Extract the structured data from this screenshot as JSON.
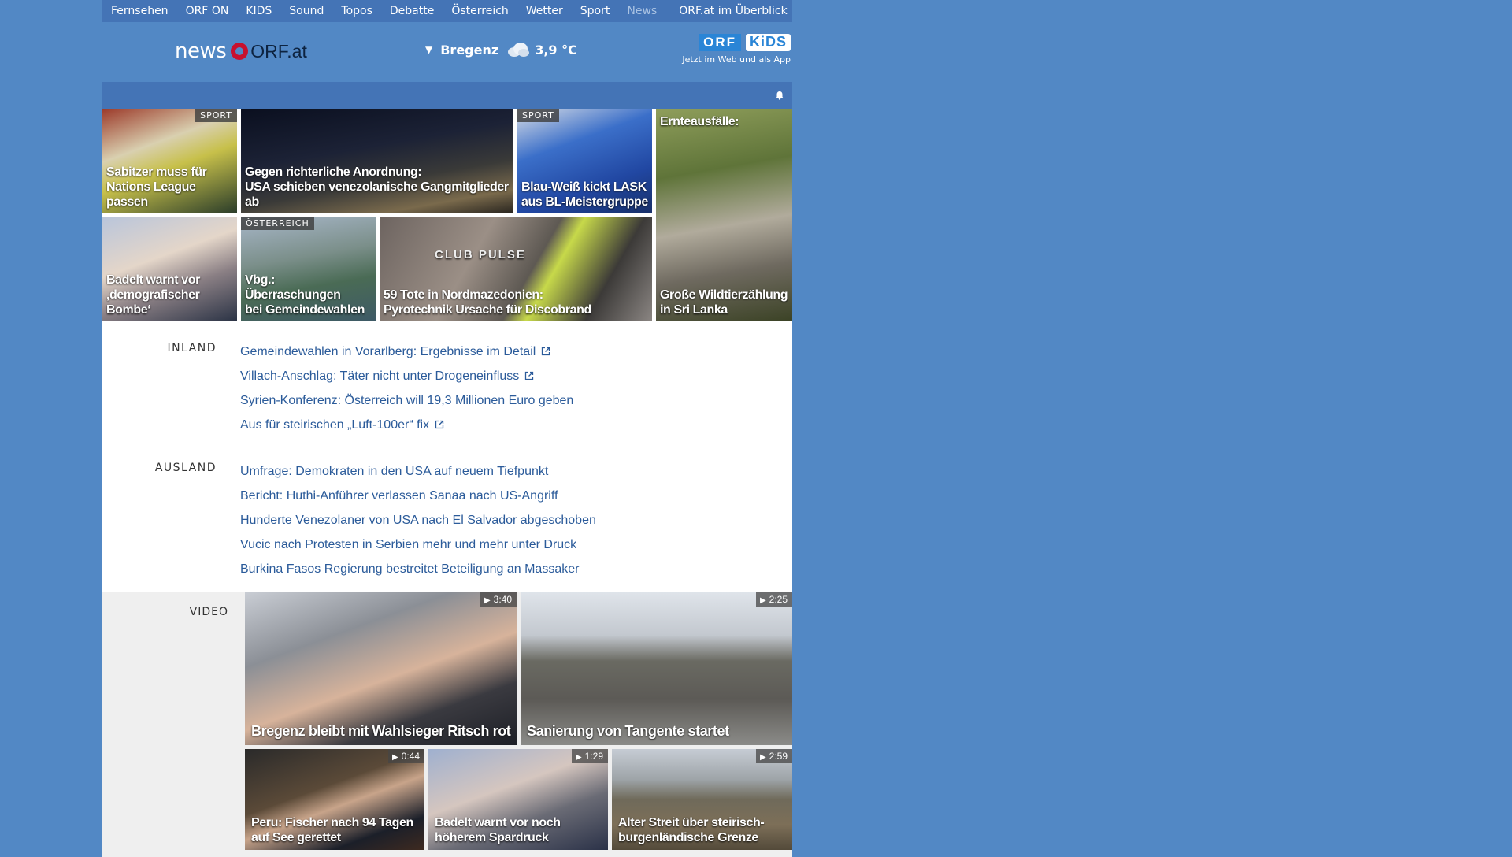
{
  "topnav": {
    "items": [
      "Fernsehen",
      "ORF ON",
      "KIDS",
      "Sound",
      "Topos",
      "Debatte",
      "Österreich",
      "Wetter",
      "Sport",
      "News"
    ],
    "overview": "ORF.at im Überblick"
  },
  "header": {
    "logo_news": "news",
    "logo_orf": "ORF.at",
    "weather": {
      "city": "Bregenz",
      "temp": "3,9 °C",
      "icon": "cloud-icon"
    },
    "kids_promo": {
      "orf": "ORF",
      "kids": "KiDS",
      "tagline": "Jetzt im Web und als App"
    }
  },
  "teasers": [
    {
      "title_line1": "Sabitzer muss für",
      "title_line2": "Nations League passen",
      "label": "SPORT"
    },
    {
      "title_line1": "Gegen richterliche Anordnung:",
      "title_line2": "USA schieben venezolanische Gangmitglieder ab"
    },
    {
      "title_line1": "Blau-Weiß kickt LASK",
      "title_line2": "aus BL-Meistergruppe",
      "label": "SPORT"
    },
    {
      "title_line1": "Ernteausfälle:",
      "title_line2": "Große Wildtierzählung",
      "title_line3": "in Sri Lanka"
    },
    {
      "title_line1": "Badelt warnt vor",
      "title_line2": "‚demografischer Bombe‘"
    },
    {
      "title_line1": "Vbg.: Überraschungen",
      "title_line2": "bei Gemeindewahlen",
      "label": "ÖSTERREICH"
    },
    {
      "title_line1": "59 Tote in Nordmazedonien:",
      "title_line2": "Pyrotechnik Ursache für Discobrand",
      "sign": "CLUB PULSE"
    }
  ],
  "inland": {
    "label": "INLAND",
    "items": [
      "Gemeindewahlen in Vorarlberg: Ergebnisse im Detail",
      "Villach-Anschlag: Täter nicht unter Drogeneinfluss",
      "Syrien-Konferenz: Österreich will 19,3 Millionen Euro geben",
      "Aus für steirischen „Luft-100er“ fix"
    ]
  },
  "ausland": {
    "label": "AUSLAND",
    "items": [
      "Umfrage: Demokraten in den USA auf neuem Tiefpunkt",
      "Bericht: Huthi-Anführer verlassen Sanaa nach US-Angriff",
      "Hunderte Venezolaner von USA nach El Salvador abgeschoben",
      "Vucic nach Protesten in Serbien mehr und mehr unter Druck",
      "Burkina Fasos Regierung bestreitet Beteiligung an Massaker"
    ]
  },
  "video": {
    "label": "VIDEO",
    "items": [
      {
        "title_line1": "Bregenz bleibt mit Wahlsieger Ritsch rot",
        "duration": "3:40"
      },
      {
        "title_line1": "Sanierung von Tangente startet",
        "duration": "2:25"
      },
      {
        "title_line1": "Peru: Fischer nach 94 Tagen",
        "title_line2": "auf See gerettet",
        "duration": "0:44"
      },
      {
        "title_line1": "Badelt warnt vor noch",
        "title_line2": "höherem Spardruck",
        "duration": "1:29"
      },
      {
        "title_line1": "Alter Streit über steirisch-",
        "title_line2": "burgenländische Grenze",
        "duration": "2:59"
      }
    ]
  }
}
